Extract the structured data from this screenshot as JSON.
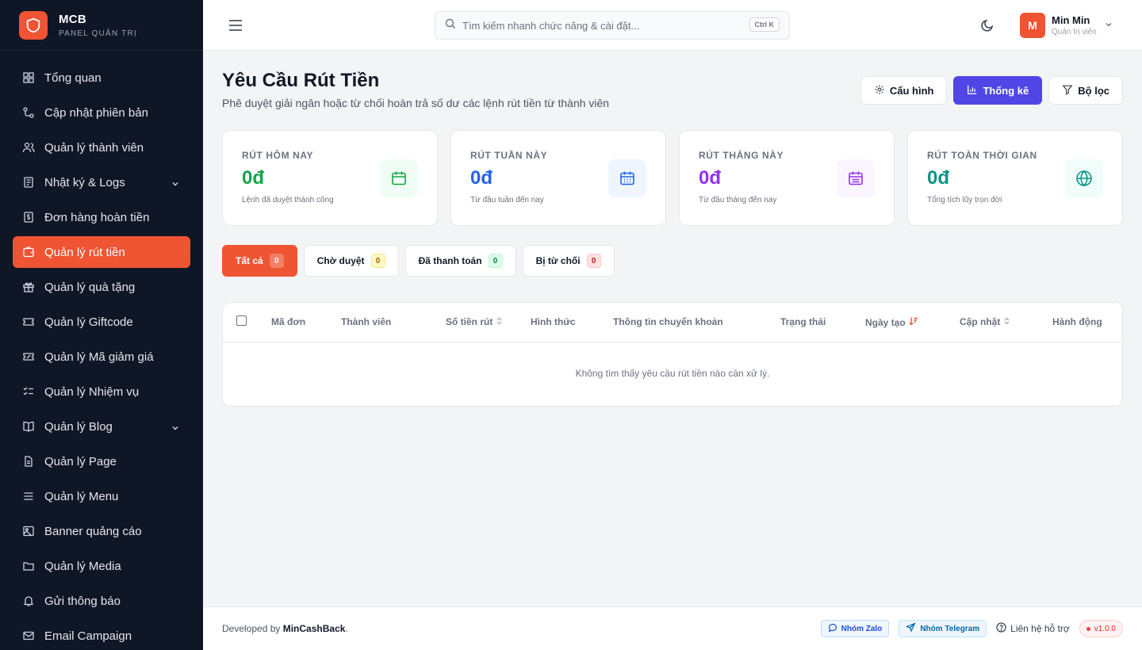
{
  "brand": {
    "name": "MCB",
    "subtitle": "PANEL QUẢN TRỊ"
  },
  "sidebar": {
    "items": [
      {
        "label": "Tổng quan",
        "icon": "dashboard-icon"
      },
      {
        "label": "Cập nhật phiên bản",
        "icon": "git-icon"
      },
      {
        "label": "Quản lý thành viên",
        "icon": "users-icon"
      },
      {
        "label": "Nhật ký & Logs",
        "icon": "logs-icon",
        "expandable": true
      },
      {
        "label": "Đơn hàng hoàn tiền",
        "icon": "receipt-icon"
      },
      {
        "label": "Quản lý rút tiền",
        "icon": "wallet-icon",
        "active": true
      },
      {
        "label": "Quản lý quà tặng",
        "icon": "gift-icon"
      },
      {
        "label": "Quản lý Giftcode",
        "icon": "ticket-icon"
      },
      {
        "label": "Quản lý Mã giảm giá",
        "icon": "coupon-icon"
      },
      {
        "label": "Quản lý Nhiệm vụ",
        "icon": "checklist-icon"
      },
      {
        "label": "Quản lý Blog",
        "icon": "book-icon",
        "expandable": true
      },
      {
        "label": "Quản lý Page",
        "icon": "page-icon"
      },
      {
        "label": "Quản lý Menu",
        "icon": "menu-icon"
      },
      {
        "label": "Banner quảng cáo",
        "icon": "image-icon"
      },
      {
        "label": "Quản lý Media",
        "icon": "folder-icon"
      },
      {
        "label": "Gửi thông báo",
        "icon": "bell-icon"
      },
      {
        "label": "Email Campaign",
        "icon": "mail-icon"
      }
    ]
  },
  "header": {
    "search_placeholder": "Tìm kiếm nhanh chức năng & cài đặt...",
    "search_shortcut": "Ctrl K",
    "user": {
      "initial": "M",
      "name": "Min Min",
      "role": "Quản trị viên"
    }
  },
  "page": {
    "title": "Yêu Cầu Rút Tiền",
    "subtitle": "Phê duyệt giải ngân hoặc từ chối hoàn trả số dư các lệnh rút tiền từ thành viên",
    "actions": {
      "config": "Cấu hình",
      "stats": "Thống kê",
      "filter": "Bộ lọc"
    }
  },
  "stats": [
    {
      "label": "RÚT HÔM NAY",
      "value": "0đ",
      "desc": "Lệnh đã duyệt thành công",
      "color": "#16a34a",
      "bg": "#f0fdf4",
      "icon": "calendar-icon"
    },
    {
      "label": "RÚT TUẦN NÀY",
      "value": "0đ",
      "desc": "Từ đầu tuần đến nay",
      "color": "#2563eb",
      "bg": "#eff6ff",
      "icon": "calendar-week-icon"
    },
    {
      "label": "RÚT THÁNG NÀY",
      "value": "0đ",
      "desc": "Từ đầu tháng đến nay",
      "color": "#9333ea",
      "bg": "#faf5ff",
      "icon": "calendar-month-icon"
    },
    {
      "label": "RÚT TOÀN THỜI GIAN",
      "value": "0đ",
      "desc": "Tổng tích lũy trọn đời",
      "color": "#0d9488",
      "bg": "#f0fdfa",
      "icon": "globe-icon"
    }
  ],
  "tabs": [
    {
      "label": "Tất cả",
      "count": "0"
    },
    {
      "label": "Chờ duyệt",
      "count": "0"
    },
    {
      "label": "Đã thanh toán",
      "count": "0"
    },
    {
      "label": "Bị từ chối",
      "count": "0"
    }
  ],
  "table": {
    "columns": [
      "Mã đơn",
      "Thành viên",
      "Số tiền rút",
      "Hình thức",
      "Thông tin chuyển khoản",
      "Trạng thái",
      "Ngày tạo",
      "Cập nhật",
      "Hành động"
    ],
    "empty": "Không tìm thấy yêu cầu rút tiền nào cần xử lý."
  },
  "footer": {
    "dev_prefix": "Developed by ",
    "dev_name": "MinCashBack",
    "dev_suffix": ".",
    "zalo": "Nhóm Zalo",
    "telegram": "Nhóm Telegram",
    "support": "Liên hệ hỗ trợ",
    "version": "v1.0.0"
  },
  "colors": {
    "accent": "#ef5433",
    "primary": "#4f46e5",
    "sidebar_bg": "#0f1626"
  }
}
